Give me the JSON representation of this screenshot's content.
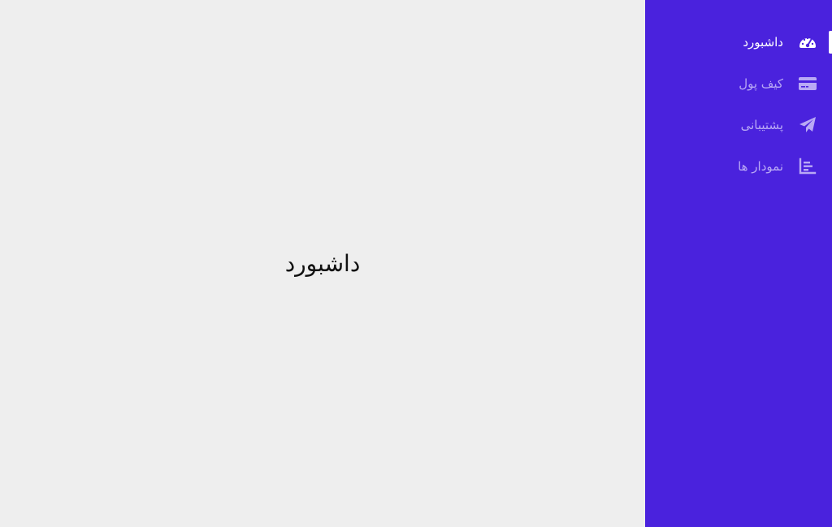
{
  "main": {
    "title": "داشبورد"
  },
  "sidebar": {
    "items": [
      {
        "label": "داشبورد",
        "icon": "dashboard-gauge-icon",
        "active": true
      },
      {
        "label": "کیف پول",
        "icon": "credit-card-icon",
        "active": false
      },
      {
        "label": "پشتیبانی",
        "icon": "paper-plane-icon",
        "active": false
      },
      {
        "label": "نمودار ها",
        "icon": "bar-chart-icon",
        "active": false
      }
    ]
  },
  "colors": {
    "sidebar_bg": "#4a22dd",
    "main_bg": "#eeeeee",
    "active_text": "#ffffff",
    "inactive_text": "#b9a9f5"
  }
}
